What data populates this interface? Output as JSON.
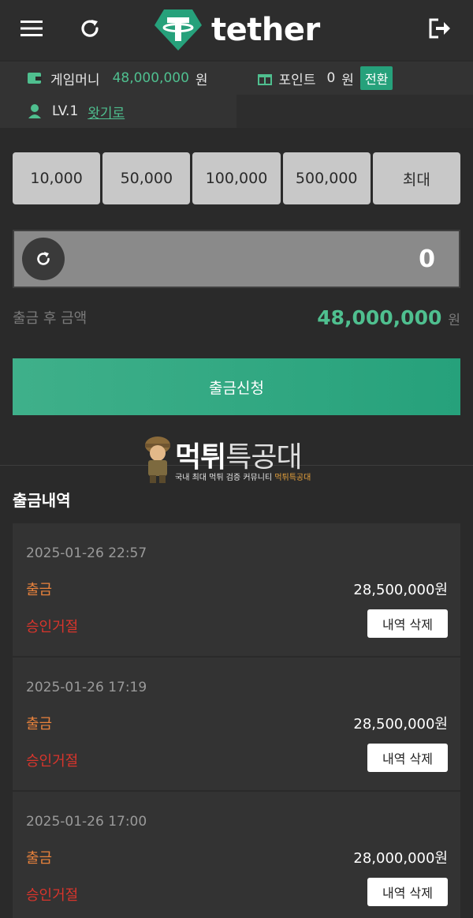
{
  "header": {
    "logo_text": "tether",
    "icons": {
      "menu": "hamburger-menu-icon",
      "refresh": "refresh-icon",
      "logout": "logout-icon",
      "logo": "tether-logo-icon"
    }
  },
  "account": {
    "game_money_label": "게임머니",
    "game_money_value": "48,000,000",
    "game_money_unit": "원",
    "point_label": "포인트",
    "point_value": "0",
    "point_unit": "원",
    "convert_label": "전환",
    "level": "LV.1",
    "level_name": "왓기로"
  },
  "amount_buttons": [
    "10,000",
    "50,000",
    "100,000",
    "500,000",
    "최대"
  ],
  "withdraw_input": {
    "value": "0"
  },
  "after_withdraw": {
    "label": "출금 후 금액",
    "amount": "48,000,000",
    "unit": "원"
  },
  "submit_label": "출금신청",
  "watermark": {
    "title_a": "먹튀",
    "title_b": "특공대",
    "subtitle": "국내 최대 먹튀 검증 커뮤니티",
    "subtitle_hl": "먹튀특공대"
  },
  "history": {
    "title": "출금내역",
    "items": [
      {
        "date": "2025-01-26 22:57",
        "type": "출금",
        "amount": "28,500,000원",
        "status": "승인거절",
        "delete_label": "내역 삭제"
      },
      {
        "date": "2025-01-26 17:19",
        "type": "출금",
        "amount": "28,500,000원",
        "status": "승인거절",
        "delete_label": "내역 삭제"
      },
      {
        "date": "2025-01-26 17:00",
        "type": "출금",
        "amount": "28,000,000원",
        "status": "승인거절",
        "delete_label": "내역 삭제"
      }
    ]
  },
  "colors": {
    "accent": "#26a17b",
    "orange": "#e8823c",
    "red": "#d9352c"
  }
}
